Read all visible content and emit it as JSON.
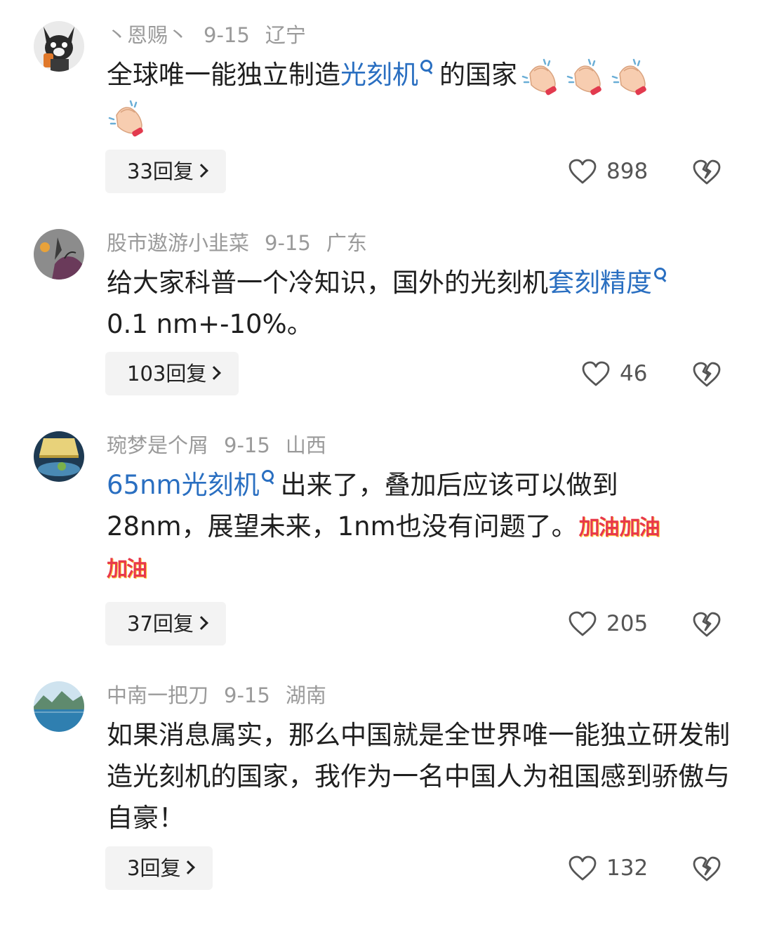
{
  "comments": [
    {
      "username": "丶恩赐丶",
      "date": "9-15",
      "location": "辽宁",
      "text_before": "全球唯一能独立制造",
      "link": "光刻机",
      "text_after": "的国家",
      "emoji": "clapping-hands-icon",
      "reply_label": "33回复",
      "likes": "898"
    },
    {
      "username": "股市遨游小韭菜",
      "date": "9-15",
      "location": "广东",
      "text_before": "给大家科普一个冷知识，国外的光刻机",
      "link": "套刻精度",
      "text_after": "0.1 nm+-10%。",
      "reply_label": "103回复",
      "likes": "46"
    },
    {
      "username": "琬梦是个屑",
      "date": "9-15",
      "location": "山西",
      "link": "65nm光刻机",
      "text_after": "出来了，叠加后应该可以做到28nm，展望未来，1nm也没有问题了。",
      "sticker_text": "加油",
      "reply_label": "37回复",
      "likes": "205"
    },
    {
      "username": "中南一把刀",
      "date": "9-15",
      "location": "湖南",
      "text": "如果消息属实，那么中国就是全世界唯一能独立研发制造光刻机的国家，我作为一名中国人为祖国感到骄傲与自豪！",
      "reply_label": "3回复",
      "likes": "132"
    }
  ],
  "colors": {
    "link": "#2a6fc1",
    "meta": "#9a9a9a",
    "sticker": "#e8394b"
  }
}
